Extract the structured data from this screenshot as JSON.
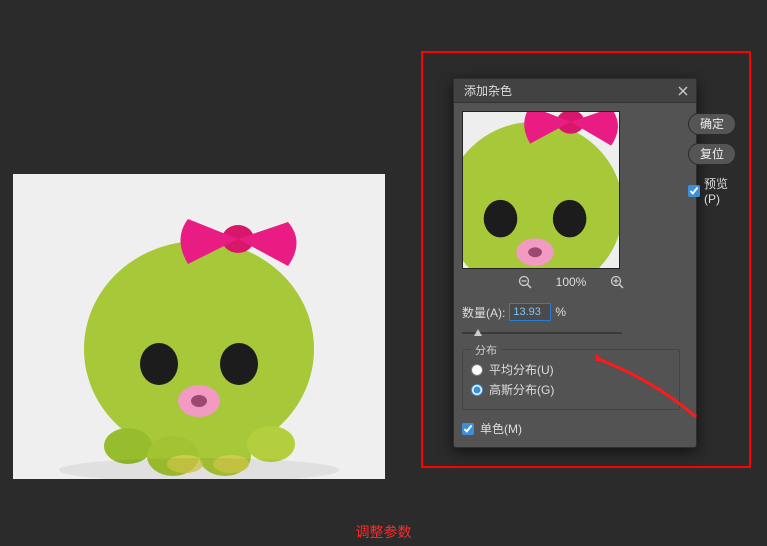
{
  "dialog": {
    "title": "添加杂色",
    "ok_label": "确定",
    "reset_label": "复位",
    "preview_label": "预览(P)",
    "preview_checked": true,
    "zoom_level": "100%",
    "amount_label": "数量(A):",
    "amount_value": "13.93",
    "amount_suffix": "%",
    "slider_percent": 10,
    "distribution_legend": "分布",
    "distribution": {
      "uniform_label": "平均分布(U)",
      "gaussian_label": "高斯分布(G)",
      "selected": "gaussian"
    },
    "monochrome_label": "单色(M)",
    "monochrome_checked": true
  },
  "caption": "调整参数"
}
